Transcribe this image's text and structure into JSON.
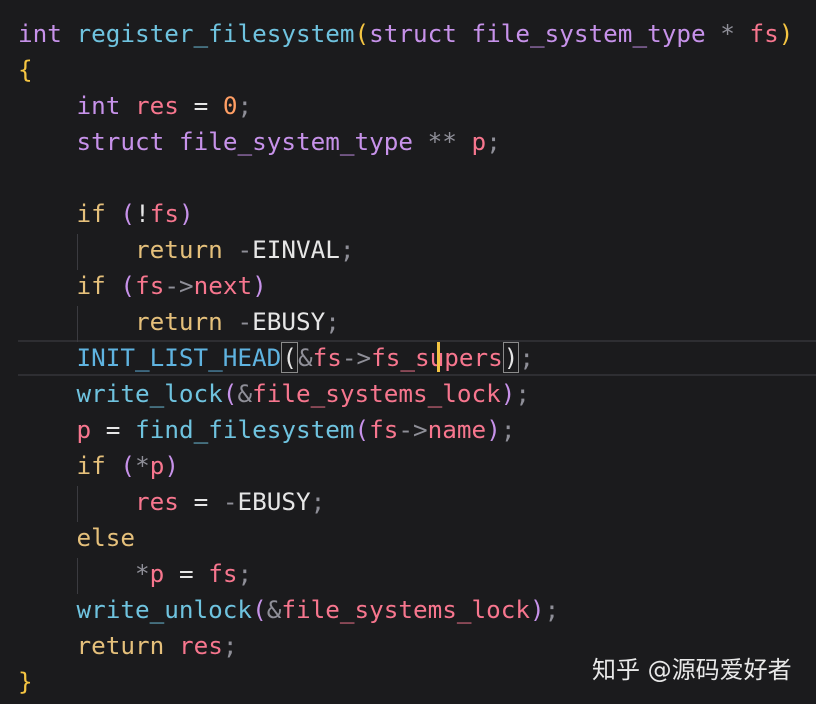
{
  "code": {
    "l1": {
      "a": "int",
      "b": "register_filesystem",
      "c": "(",
      "d": "struct",
      "e": "file_system_type",
      "f": "*",
      "g": "fs",
      "h": ")"
    },
    "l2": {
      "a": "{"
    },
    "l3": {
      "a": "int",
      "b": "res",
      "c": "=",
      "d": "0",
      "e": ";"
    },
    "l4": {
      "a": "struct",
      "b": "file_system_type",
      "c": "**",
      "d": "p",
      "e": ";"
    },
    "l6": {
      "a": "if",
      "b": "(",
      "c": "!",
      "d": "fs",
      "e": ")"
    },
    "l7": {
      "a": "return",
      "b": "-",
      "c": "EINVAL",
      "d": ";"
    },
    "l8": {
      "a": "if",
      "b": "(",
      "c": "fs",
      "d": "->",
      "e": "next",
      "f": ")"
    },
    "l9": {
      "a": "return",
      "b": "-",
      "c": "EBUSY",
      "d": ";"
    },
    "l10": {
      "a": "INIT_LIST_HEAD",
      "b": "(",
      "c": "&",
      "d": "fs",
      "e": "->",
      "f": "fs_supers",
      "g": ")",
      "h": ";"
    },
    "l11": {
      "a": "write_lock",
      "b": "(",
      "c": "&",
      "d": "file_systems_lock",
      "e": ")",
      "f": ";"
    },
    "l12": {
      "a": "p",
      "b": "=",
      "c": "find_filesystem",
      "d": "(",
      "e": "fs",
      "f": "->",
      "g": "name",
      "h": ")",
      "i": ";"
    },
    "l13": {
      "a": "if",
      "b": "(",
      "c": "*",
      "d": "p",
      "e": ")"
    },
    "l14": {
      "a": "res",
      "b": "=",
      "c": "-",
      "d": "EBUSY",
      "e": ";"
    },
    "l15": {
      "a": "else"
    },
    "l16": {
      "a": "*",
      "b": "p",
      "c": "=",
      "d": "fs",
      "e": ";"
    },
    "l17": {
      "a": "write_unlock",
      "b": "(",
      "c": "&",
      "d": "file_systems_lock",
      "e": ")",
      "f": ";"
    },
    "l18": {
      "a": "return",
      "b": "res",
      "c": ";"
    },
    "l19": {
      "a": "}"
    }
  },
  "watermark": "知乎 @源码爱好者",
  "colors": {
    "background": "#1b1b1d",
    "caret": "#f5c542"
  }
}
